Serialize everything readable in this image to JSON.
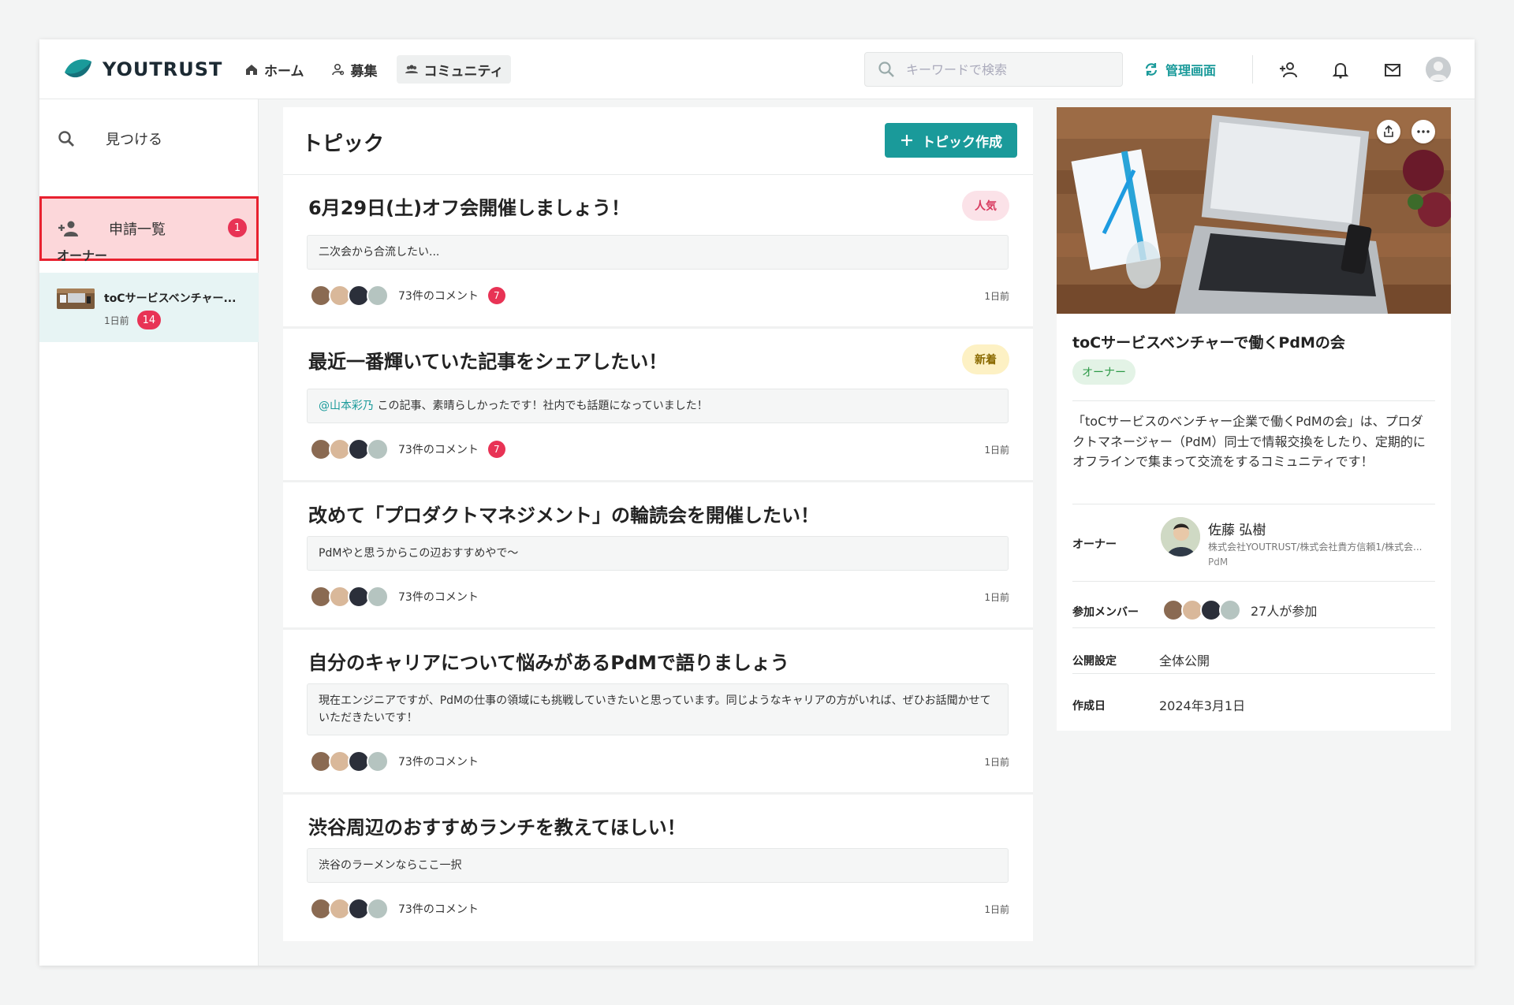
{
  "header": {
    "logo_text": "YOUTRUST",
    "nav": [
      {
        "label": "ホーム",
        "icon": "home-icon"
      },
      {
        "label": "募集",
        "icon": "person-search-icon"
      },
      {
        "label": "コミュニティ",
        "icon": "group-icon"
      }
    ],
    "search_placeholder": "キーワードで検索",
    "admin_label": "管理画面"
  },
  "sidebar": {
    "find_label": "見つける",
    "requests_label": "申請一覧",
    "requests_count": "1",
    "owner_label": "オーナー",
    "community": {
      "name": "toCサービスベンチャー...",
      "ago": "1日前",
      "count": "14"
    }
  },
  "main": {
    "title": "トピック",
    "create_label": "トピック作成",
    "topics": [
      {
        "title": "6月29日(土)オフ会開催しましょう！",
        "tag": "人気",
        "preview": "二次会から合流したい...",
        "comments": "73件のコメント",
        "badge": "7",
        "ago": "1日前"
      },
      {
        "title": "最近一番輝いていた記事をシェアしたい！",
        "tag": "新着",
        "mention": "@山本彩乃",
        "preview": " この記事、素晴らしかったです！社内でも話題になっていました！",
        "comments": "73件のコメント",
        "badge": "7",
        "ago": "1日前"
      },
      {
        "title": "改めて「プロダクトマネジメント」の輪読会を開催したい！",
        "preview": "PdMやと思うからこの辺おすすめやで〜",
        "comments": "73件のコメント",
        "ago": "1日前"
      },
      {
        "title": "自分のキャリアについて悩みがあるPdMで語りましょう",
        "preview": "現在エンジニアですが、PdMの仕事の領域にも挑戦していきたいと思っています。同じようなキャリアの方がいれば、ぜひお話聞かせていただきたいです！",
        "comments": "73件のコメント",
        "ago": "1日前"
      },
      {
        "title": "渋谷周辺のおすすめランチを教えてほしい！",
        "preview": "渋谷のラーメンならここ一択",
        "comments": "73件のコメント",
        "ago": "1日前"
      }
    ]
  },
  "panel": {
    "title": "toCサービスベンチャーで働くPdMの会",
    "owner_tag": "オーナー",
    "description": "「toCサービスのベンチャー企業で働くPdMの会」は、プロダクトマネージャー（PdM）同士で情報交換をしたり、定期的にオフラインで集まって交流をするコミュニティです！",
    "owner_label": "オーナー",
    "owner_name": "佐藤 弘樹",
    "owner_org": "株式会社YOUTRUST/株式会社貴方信頼1/株式会...",
    "owner_role": "PdM",
    "members_label": "参加メンバー",
    "members_text": "27人が参加",
    "visibility_label": "公開設定",
    "visibility_value": "全体公開",
    "created_label": "作成日",
    "created_value": "2024年3月1日"
  },
  "colors": {
    "accent": "#1a9a9a",
    "badge": "#e83355",
    "highlight_border": "#e8212f"
  }
}
